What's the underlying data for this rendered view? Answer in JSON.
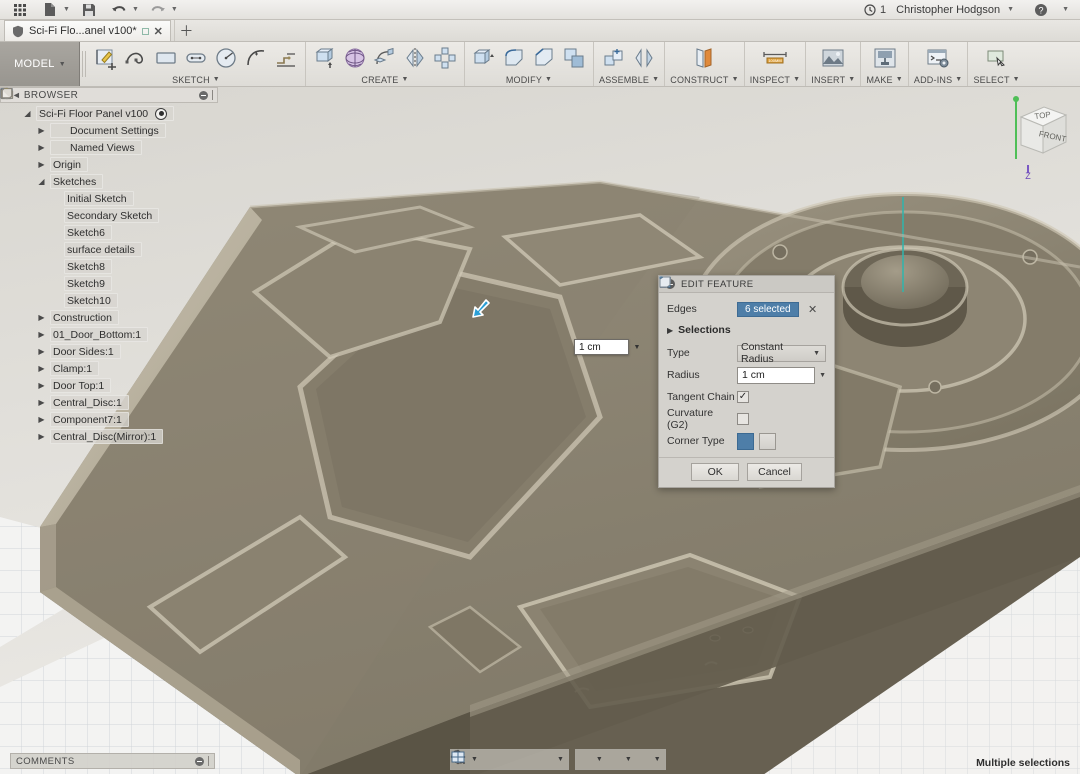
{
  "topbar": {
    "grid_icon": "app-grid-icon",
    "file_icon": "file-icon",
    "save_icon": "save-icon",
    "undo_icon": "undo-icon",
    "redo_icon": "redo-icon",
    "jobs_icon": "clock-icon",
    "jobs_count": "1",
    "user_name": "Christopher Hodgson",
    "help_icon": "help-icon"
  },
  "tabbar": {
    "tab_title": "Sci-Fi Flo...anel v100*",
    "tab_shield_icon": "shield-icon",
    "tab_close_icon": "close-icon",
    "new_tab_icon": "plus-icon"
  },
  "ribbon": {
    "workspace": "MODEL",
    "panels": [
      {
        "label": "SKETCH",
        "tools": [
          "create-sketch-icon",
          "spline-icon",
          "rectangle-icon",
          "slot-icon",
          "circle-icon",
          "arc-icon",
          "sketch-dimension-icon"
        ]
      },
      {
        "label": "CREATE",
        "tools": [
          "extrude-icon",
          "revolve-icon",
          "sweep-icon",
          "loft-icon",
          "coil-icon",
          "mirror-icon",
          "pattern-icon"
        ]
      },
      {
        "label": "MODIFY",
        "tools": [
          "press-pull-icon",
          "fillet-icon",
          "chamfer-icon",
          "shell-icon",
          "combine-icon"
        ]
      },
      {
        "label": "ASSEMBLE",
        "tools": [
          "new-component-icon",
          "joint-icon"
        ]
      },
      {
        "label": "CONSTRUCT",
        "tools": [
          "offset-plane-icon"
        ]
      },
      {
        "label": "INSPECT",
        "tools": [
          "measure-icon"
        ]
      },
      {
        "label": "INSERT",
        "tools": [
          "insert-image-icon"
        ]
      },
      {
        "label": "MAKE",
        "tools": [
          "3d-print-icon"
        ]
      },
      {
        "label": "ADD-INS",
        "tools": [
          "scripts-addins-icon"
        ]
      },
      {
        "label": "SELECT",
        "tools": [
          "select-icon"
        ]
      }
    ]
  },
  "browser": {
    "title": "BROWSER",
    "collapse_icon": "collapse-arrows-icon",
    "options_icon": "panel-options-icon",
    "root": {
      "label": "Sci-Fi Floor Panel v100",
      "bulb_icon": "lightbulb-on-icon",
      "doc_icon": "document-icon",
      "focus_icon": "focus-target-icon"
    },
    "items": [
      {
        "label": "Document Settings",
        "indent": 1,
        "tri": "closed",
        "bulb": "none",
        "icon": "gear-icon"
      },
      {
        "label": "Named Views",
        "indent": 1,
        "tri": "closed",
        "bulb": "none",
        "icon": "folder-icon"
      },
      {
        "label": "Origin",
        "indent": 1,
        "tri": "closed",
        "bulb": "off",
        "icon": "folder-icon"
      },
      {
        "label": "Sketches",
        "indent": 1,
        "tri": "open",
        "bulb": "on",
        "icon": "folder-icon"
      },
      {
        "label": "Initial Sketch",
        "indent": 2,
        "tri": "none",
        "bulb": "on",
        "icon": "sketch-icon"
      },
      {
        "label": "Secondary Sketch",
        "indent": 2,
        "tri": "none",
        "bulb": "off",
        "icon": "sketch-icon"
      },
      {
        "label": "Sketch6",
        "indent": 2,
        "tri": "none",
        "bulb": "off",
        "icon": "sketch-icon"
      },
      {
        "label": "surface details",
        "indent": 2,
        "tri": "none",
        "bulb": "off",
        "icon": "sketch-icon"
      },
      {
        "label": "Sketch8",
        "indent": 2,
        "tri": "none",
        "bulb": "off",
        "icon": "sketch-icon"
      },
      {
        "label": "Sketch9",
        "indent": 2,
        "tri": "none",
        "bulb": "off",
        "icon": "sketch-icon"
      },
      {
        "label": "Sketch10",
        "indent": 2,
        "tri": "none",
        "bulb": "off",
        "icon": "sketch-icon"
      },
      {
        "label": "Construction",
        "indent": 1,
        "tri": "closed",
        "bulb": "on",
        "icon": "folder-icon"
      },
      {
        "label": "01_Door_Bottom:1",
        "indent": 1,
        "tri": "closed",
        "bulb": "on",
        "icon": "body-icon"
      },
      {
        "label": "Door Sides:1",
        "indent": 1,
        "tri": "closed",
        "bulb": "on",
        "icon": "body-icon"
      },
      {
        "label": "Clamp:1",
        "indent": 1,
        "tri": "closed",
        "bulb": "on",
        "icon": "body-icon"
      },
      {
        "label": "Door Top:1",
        "indent": 1,
        "tri": "closed",
        "bulb": "on",
        "icon": "body-icon"
      },
      {
        "label": "Central_Disc:1",
        "indent": 1,
        "tri": "closed",
        "bulb": "on",
        "icon": "body-icon"
      },
      {
        "label": "Component7:1",
        "indent": 1,
        "tri": "closed",
        "bulb": "on",
        "icon": "body-icon"
      },
      {
        "label": "Central_Disc(Mirror):1",
        "indent": 1,
        "tri": "closed",
        "bulb": "on",
        "icon": "body-icon"
      }
    ]
  },
  "dialog": {
    "title": "EDIT FEATURE",
    "collapse_icon": "collapse-icon",
    "edges_label": "Edges",
    "edges_value": "6 selected",
    "edges_cursor_icon": "selection-arrow-icon",
    "edges_clear_icon": "clear-selection-icon",
    "selections_label": "Selections",
    "type_label": "Type",
    "type_value": "Constant Radius",
    "type_icon": "fillet-type-icon",
    "radius_label": "Radius",
    "radius_value": "1 cm",
    "tangent_label": "Tangent Chain",
    "tangent_checked": "✓",
    "curvature_label": "Curvature (G2)",
    "curvature_checked": "",
    "corner_label": "Corner Type",
    "corner_option_a_icon": "rolling-ball-corner-icon",
    "corner_option_b_icon": "setback-corner-icon",
    "ok_label": "OK",
    "cancel_label": "Cancel",
    "accent_color": "#4e7ea8"
  },
  "canvas": {
    "dimension_value": "1 cm",
    "dimension_caret_icon": "chevron-down-icon",
    "manipulator_icon": "arrow-handle-icon",
    "viewcube": {
      "top_face": "TOP",
      "front_face": "FRONT",
      "axis_label": "Z"
    },
    "model_color": "#87806f",
    "model_highlight": "#cfc8b6",
    "grid_color": "#c9cdd2"
  },
  "statusbar": {
    "comments_label": "COMMENTS",
    "comments_options_icon": "panel-options-icon",
    "selection_status": "Multiple selections",
    "nav_tools": [
      {
        "icon": "orbit-icon",
        "caret": true
      },
      {
        "icon": "look-at-icon",
        "caret": false
      },
      {
        "icon": "pan-icon",
        "caret": false
      },
      {
        "icon": "zoom-icon",
        "caret": false
      },
      {
        "icon": "fit-icon",
        "caret": true
      }
    ],
    "display_tools": [
      {
        "icon": "display-settings-icon",
        "caret": true
      },
      {
        "icon": "grid-snaps-icon",
        "caret": true
      },
      {
        "icon": "viewports-icon",
        "caret": true
      }
    ]
  }
}
